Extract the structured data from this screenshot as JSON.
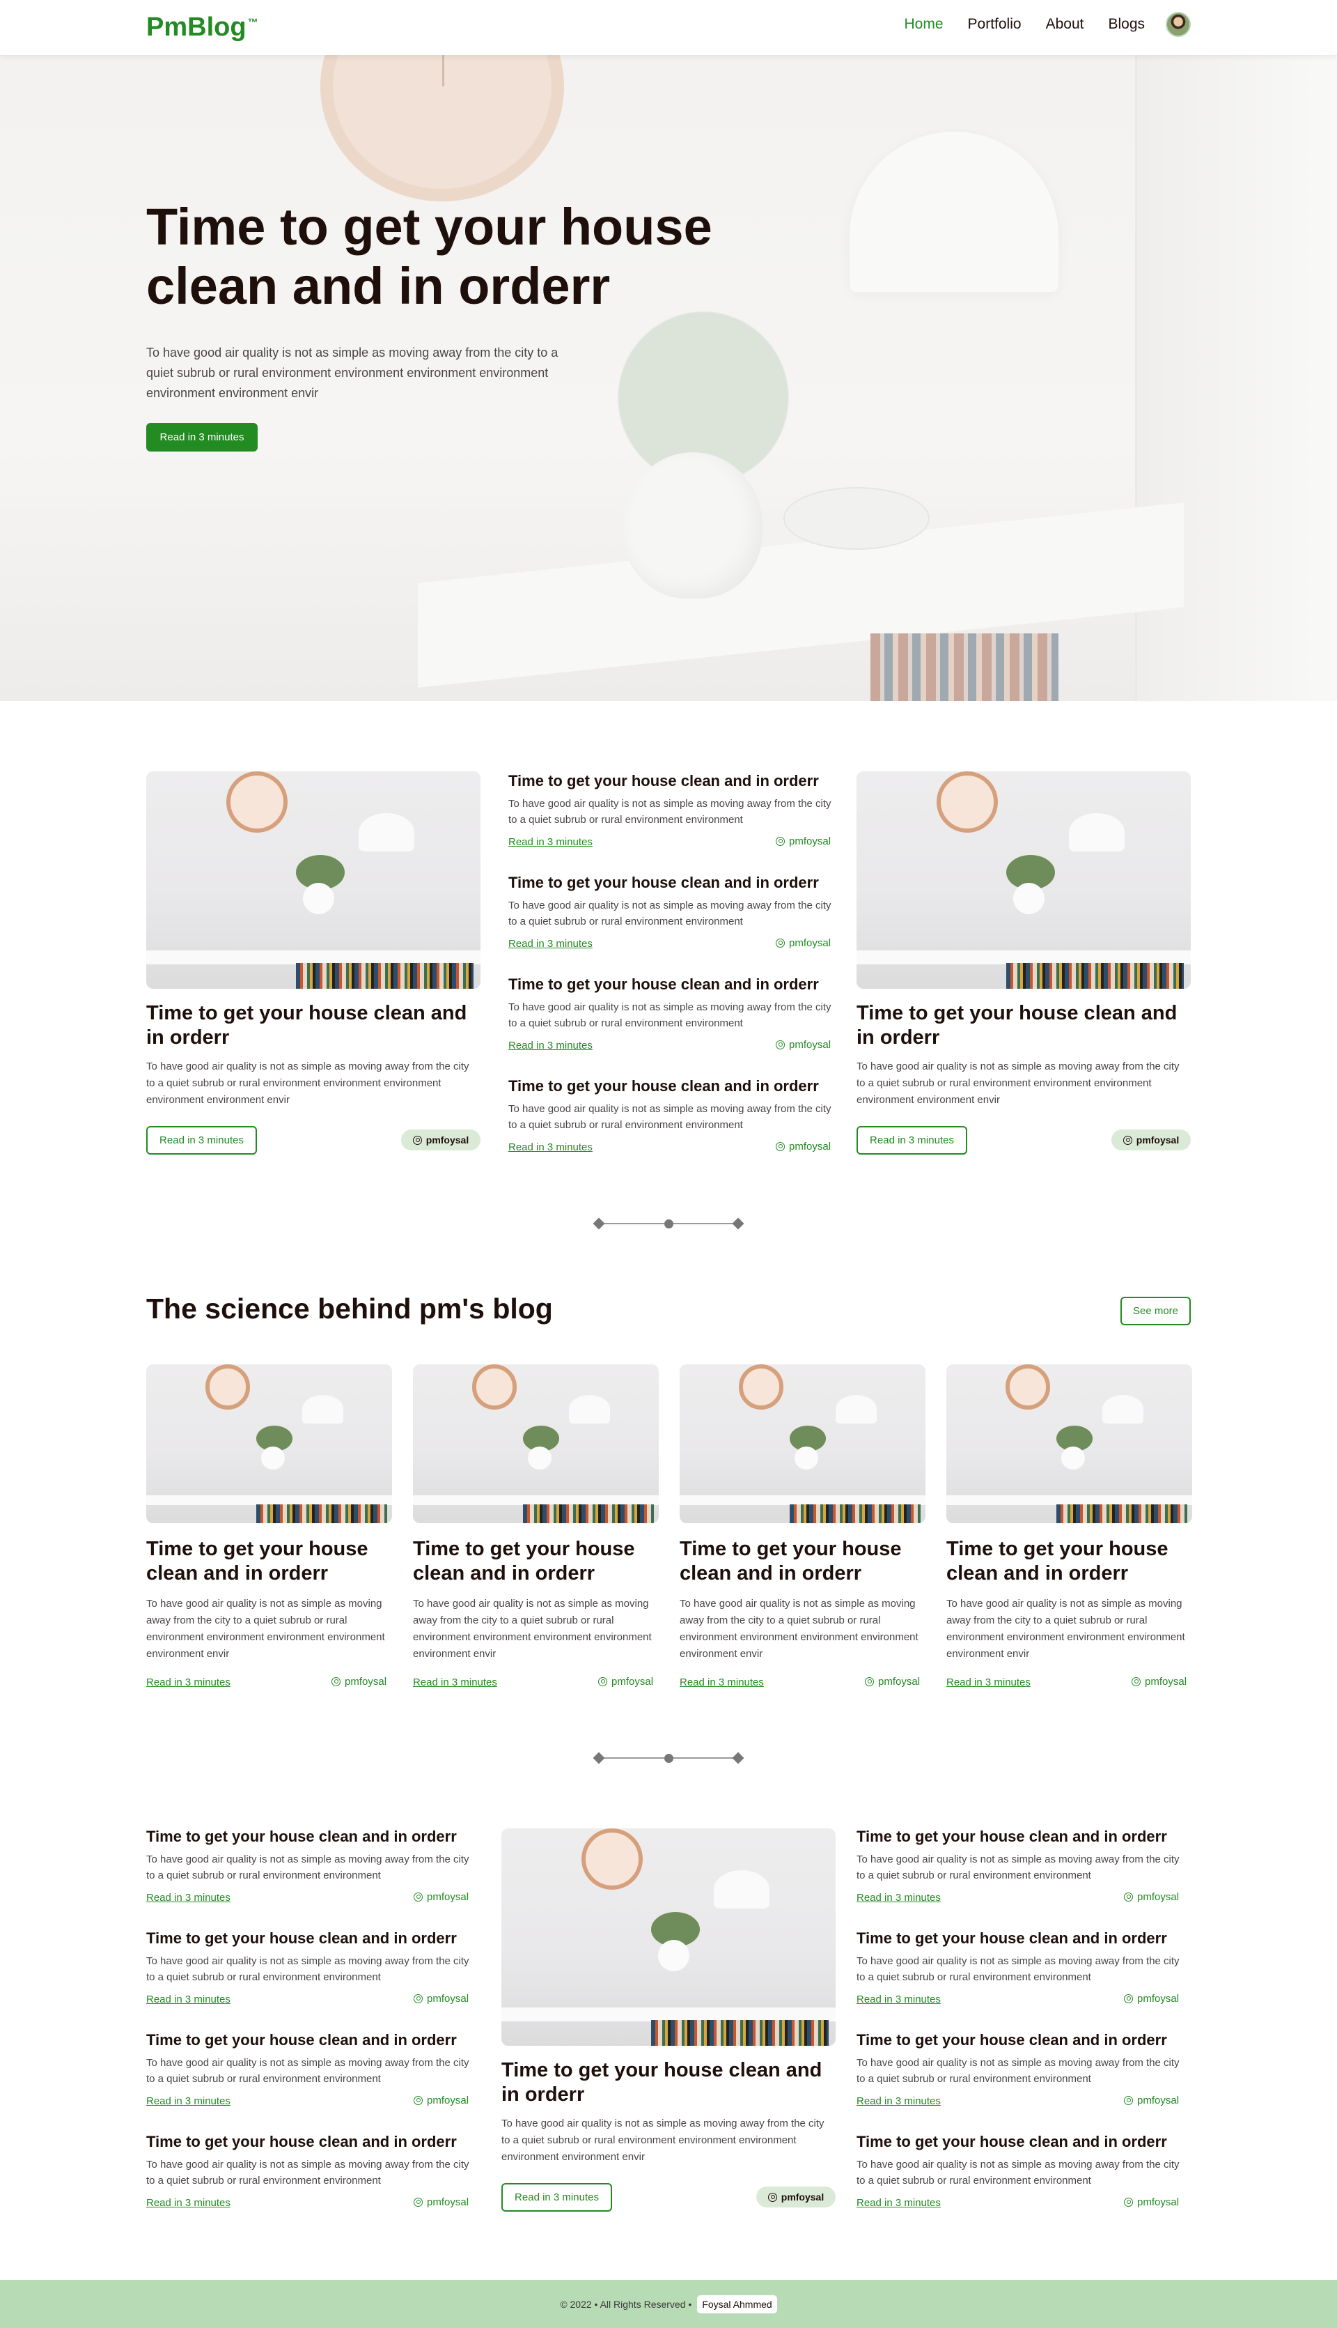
{
  "header": {
    "logo": "PmBlog",
    "trademark": "™",
    "nav": [
      "Home",
      "Portfolio",
      "About",
      "Blogs"
    ],
    "active": "Home"
  },
  "hero": {
    "title": "Time to get your house clean and in orderr",
    "description": "To have good air quality is not as simple as moving away from the city to a quiet subrub or rural environment environment environment environment environment environment envir",
    "button": "Read in 3 minutes"
  },
  "featured_1": {
    "left": {
      "title": "Time to get your house clean and in orderr",
      "description": "To have good air quality is not as simple as moving away from the city to a quiet subrub or rural environment environment environment environment environment envir",
      "button": "Read in 3 minutes",
      "author": "pmfoysal"
    },
    "middle": [
      {
        "title": "Time to get your house clean and in orderr",
        "description": "To have good air quality is not as simple as moving away from the city to a quiet subrub or rural environment environment",
        "link": "Read in 3 minutes",
        "author": "pmfoysal"
      },
      {
        "title": "Time to get your house clean and in orderr",
        "description": "To have good air quality is not as simple as moving away from the city to a quiet subrub or rural environment environment",
        "link": "Read in 3 minutes",
        "author": "pmfoysal"
      },
      {
        "title": "Time to get your house clean and in orderr",
        "description": "To have good air quality is not as simple as moving away from the city to a quiet subrub or rural environment environment",
        "link": "Read in 3 minutes",
        "author": "pmfoysal"
      },
      {
        "title": "Time to get your house clean and in orderr",
        "description": "To have good air quality is not as simple as moving away from the city to a quiet subrub or rural environment environment",
        "link": "Read in 3 minutes",
        "author": "pmfoysal"
      }
    ],
    "right": {
      "title": "Time to get your house clean and in orderr",
      "description": "To have good air quality is not as simple as moving away from the city to a quiet subrub or rural environment environment environment environment environment envir",
      "button": "Read in 3 minutes",
      "author": "pmfoysal"
    }
  },
  "science": {
    "title": "The science behind pm's blog",
    "see_more": "See more",
    "cards": [
      {
        "title": "Time to get your house clean and in orderr",
        "description": "To have good air quality is not as simple as moving away from the city to a quiet subrub or rural environment environment environment environment environment envir",
        "link": "Read in 3 minutes",
        "author": "pmfoysal"
      },
      {
        "title": "Time to get your house clean and in orderr",
        "description": "To have good air quality is not as simple as moving away from the city to a quiet subrub or rural environment environment environment environment environment envir",
        "link": "Read in 3 minutes",
        "author": "pmfoysal"
      },
      {
        "title": "Time to get your house clean and in orderr",
        "description": "To have good air quality is not as simple as moving away from the city to a quiet subrub or rural environment environment environment environment environment envir",
        "link": "Read in 3 minutes",
        "author": "pmfoysal"
      },
      {
        "title": "Time to get your house clean and in orderr",
        "description": "To have good air quality is not as simple as moving away from the city to a quiet subrub or rural environment environment environment environment environment envir",
        "link": "Read in 3 minutes",
        "author": "pmfoysal"
      }
    ]
  },
  "featured_2": {
    "left": [
      {
        "title": "Time to get your house clean and in orderr",
        "description": "To have good air quality is not as simple as moving away from the city to a quiet subrub or rural environment environment",
        "link": "Read in 3 minutes",
        "author": "pmfoysal"
      },
      {
        "title": "Time to get your house clean and in orderr",
        "description": "To have good air quality is not as simple as moving away from the city to a quiet subrub or rural environment environment",
        "link": "Read in 3 minutes",
        "author": "pmfoysal"
      },
      {
        "title": "Time to get your house clean and in orderr",
        "description": "To have good air quality is not as simple as moving away from the city to a quiet subrub or rural environment environment",
        "link": "Read in 3 minutes",
        "author": "pmfoysal"
      },
      {
        "title": "Time to get your house clean and in orderr",
        "description": "To have good air quality is not as simple as moving away from the city to a quiet subrub or rural environment environment",
        "link": "Read in 3 minutes",
        "author": "pmfoysal"
      }
    ],
    "center": {
      "title": "Time to get your house clean and in orderr",
      "description": "To have good air quality is not as simple as moving away from the city to a quiet subrub or rural environment environment environment environment environment envir",
      "button": "Read in 3 minutes",
      "author": "pmfoysal"
    },
    "right": [
      {
        "title": "Time to get your house clean and in orderr",
        "description": "To have good air quality is not as simple as moving away from the city to a quiet subrub or rural environment environment",
        "link": "Read in 3 minutes",
        "author": "pmfoysal"
      },
      {
        "title": "Time to get your house clean and in orderr",
        "description": "To have good air quality is not as simple as moving away from the city to a quiet subrub or rural environment environment",
        "link": "Read in 3 minutes",
        "author": "pmfoysal"
      },
      {
        "title": "Time to get your house clean and in orderr",
        "description": "To have good air quality is not as simple as moving away from the city to a quiet subrub or rural environment environment",
        "link": "Read in 3 minutes",
        "author": "pmfoysal"
      },
      {
        "title": "Time to get your house clean and in orderr",
        "description": "To have good air quality is not as simple as moving away from the city to a quiet subrub or rural environment environment",
        "link": "Read in 3 minutes",
        "author": "pmfoysal"
      }
    ]
  },
  "footer": {
    "copyright": "© 2022 • All Rights Reserved •",
    "name": "Foysal Ahmmed"
  },
  "colors": {
    "accent": "#228b22",
    "text": "#1e0f0b",
    "footer_bg": "#b7dbb4",
    "pill_bg": "#dbead7"
  },
  "icons": {
    "author": "user-circle-icon"
  }
}
